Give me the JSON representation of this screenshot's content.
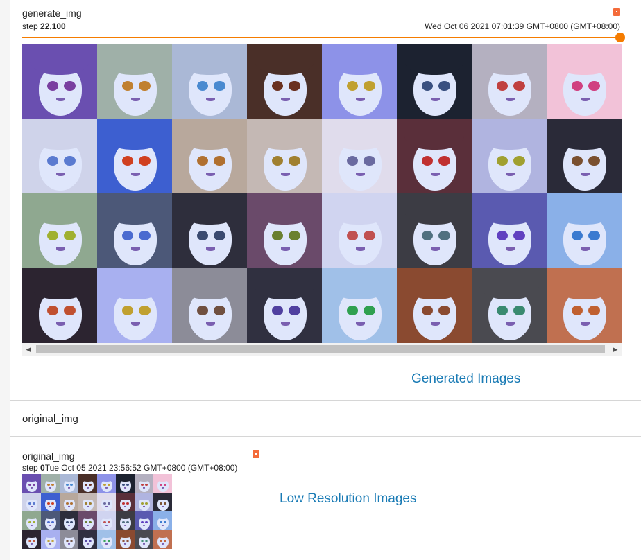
{
  "generate": {
    "title": "generate_img",
    "step_label": "step",
    "step_value": "22,100",
    "timestamp": "Wed Oct 06 2021 07:01:39 GMT+0800 (GMT+08:00)",
    "slider_position": 1.0,
    "caption": "Generated Images",
    "grid": {
      "rows": 4,
      "cols": 8
    }
  },
  "scrollbar": {
    "left_icon": "arrow-left-icon",
    "right_icon": "arrow-right-icon"
  },
  "original_section": {
    "header": "original_img"
  },
  "original": {
    "title": "original_img",
    "step_label": "step",
    "step_value": "0",
    "timestamp": "Tue Oct 05 2021 23:56:52 GMT+0800 (GMT+08:00)",
    "caption": "Low Resolution Images",
    "grid": {
      "rows": 4,
      "cols": 8
    }
  },
  "colors": {
    "accent": "#f57c00",
    "caption": "#1a7bb5",
    "pin": "#f46b3a",
    "hair_palette": [
      "#6a4fb0",
      "#9fb0a8",
      "#aab8d6",
      "#4a2f28",
      "#8d92e8",
      "#1c2230",
      "#b4b0c0",
      "#f2c2d8",
      "#cfd3ea",
      "#3d5fd0",
      "#b8a89c",
      "#c4b8b4",
      "#e0dcec",
      "#5a2f3a",
      "#b0b4e0",
      "#2a2a38",
      "#8fa890",
      "#4c5878",
      "#2e2e3c",
      "#6a4a6a",
      "#d0d4f0",
      "#3c3c44",
      "#5a5ab0",
      "#8ab0e8",
      "#2c2430",
      "#a8b0f0",
      "#8c8c98",
      "#303040",
      "#a0c0e8",
      "#8a4a30",
      "#4a4a50",
      "#c07050"
    ],
    "eye_palette": [
      "#7a3fa0",
      "#c08030",
      "#4a8ad0",
      "#6a3020",
      "#c0a030",
      "#3a5080",
      "#c04040",
      "#d04080",
      "#5a7ad0",
      "#d04020",
      "#b07030",
      "#a08030",
      "#6a6aa0",
      "#c03030",
      "#a0a030",
      "#7a5030",
      "#a0b030",
      "#4a6ad0",
      "#3a4a70",
      "#6a8030",
      "#c05050",
      "#507080",
      "#6040c0",
      "#3a7ad0",
      "#c05030",
      "#c0a030",
      "#705040",
      "#5040a0",
      "#30a050",
      "#8a4a30",
      "#3a8a70",
      "#c06030"
    ]
  }
}
